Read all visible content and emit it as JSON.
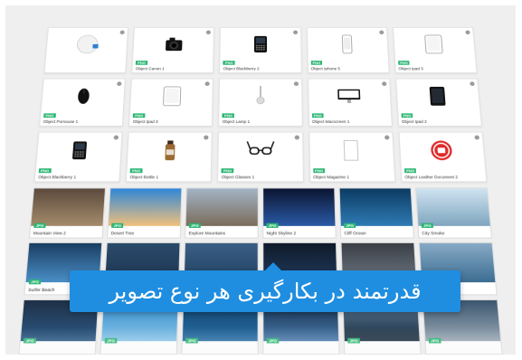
{
  "overlay": {
    "title": "قدرتمند در بکارگیری هر نوع تصویر"
  },
  "objects": {
    "row1": [
      {
        "label": "",
        "badge": "",
        "icon": "badge-mockup-icon"
      },
      {
        "label": "Object Canon 1",
        "badge": "PNG",
        "icon": "camera-icon"
      },
      {
        "label": "Object Blackberry 2",
        "badge": "PNG",
        "icon": "phone-keyboard-icon"
      },
      {
        "label": "Object Iphone 5",
        "badge": "PNG",
        "icon": "phone-icon"
      },
      {
        "label": "Object Ipad 3",
        "badge": "PNG",
        "icon": "tablet-icon"
      }
    ],
    "row2": [
      {
        "label": "Object Pomouse 1",
        "badge": "PNG",
        "icon": "mouse-icon"
      },
      {
        "label": "Object Ipad 3",
        "badge": "PNG",
        "icon": "tablet-icon"
      },
      {
        "label": "Object Lamp 1",
        "badge": "PNG",
        "icon": "lamp-icon"
      },
      {
        "label": "Object Macscreen 1",
        "badge": "PNG",
        "icon": "monitor-icon"
      },
      {
        "label": "Object Ipad 2",
        "badge": "PNG",
        "icon": "tablet-black-icon"
      }
    ],
    "row3": [
      {
        "label": "Object Blackberry 1",
        "badge": "PNG",
        "icon": "phone-keyboard-icon"
      },
      {
        "label": "Object Bottle 1",
        "badge": "PNG",
        "icon": "bottle-icon"
      },
      {
        "label": "Object Glasses 1",
        "badge": "PNG",
        "icon": "glasses-icon"
      },
      {
        "label": "Object Magazine 1",
        "badge": "PNG",
        "icon": "paper-icon"
      },
      {
        "label": "Object Leather Document 2",
        "badge": "PNG",
        "icon": "logo-icon"
      }
    ]
  },
  "photos": {
    "row1": [
      {
        "label": "Mountain View 2",
        "badge": "JPG",
        "colors": [
          "#5b4a3d",
          "#a48b6b"
        ]
      },
      {
        "label": "Desert Tree",
        "badge": "JPG",
        "colors": [
          "#2f87d8",
          "#f0c07b"
        ]
      },
      {
        "label": "Explore Mountains",
        "badge": "JPG",
        "colors": [
          "#a3b4c6",
          "#7b6c5a"
        ]
      },
      {
        "label": "Night Skyline 2",
        "badge": "JPG",
        "colors": [
          "#0b1430",
          "#2a5aa6"
        ]
      },
      {
        "label": "Cliff Ocean",
        "badge": "JPG",
        "colors": [
          "#0c3b61",
          "#2f7bb5"
        ]
      },
      {
        "label": "City Smoke",
        "badge": "JPG",
        "colors": [
          "#cfe3f0",
          "#7fa6bf"
        ]
      }
    ],
    "row2": [
      {
        "label": "Surfer Beach",
        "badge": "JPG",
        "colors": [
          "#1a3d62",
          "#4a8fc7"
        ]
      },
      {
        "label": "",
        "badge": "",
        "colors": [
          "#2b4b6b",
          "#1d3550"
        ]
      },
      {
        "label": "",
        "badge": "",
        "colors": [
          "#3a5f86",
          "#20405e"
        ]
      },
      {
        "label": "",
        "badge": "",
        "colors": [
          "#0f1a2a",
          "#203b5d"
        ]
      },
      {
        "label": "",
        "badge": "",
        "colors": [
          "#3b3f46",
          "#6c7784"
        ]
      },
      {
        "label": "",
        "badge": "",
        "colors": [
          "#87aac6",
          "#3c6d92"
        ]
      }
    ],
    "row3": [
      {
        "label": "",
        "badge": "JPG",
        "colors": [
          "#1e2f45",
          "#2d5a87"
        ]
      },
      {
        "label": "",
        "badge": "JPG",
        "colors": [
          "#2a86c7",
          "#8cc6ea"
        ]
      },
      {
        "label": "",
        "badge": "JPG",
        "colors": [
          "#0e3d66",
          "#2a70a7"
        ]
      },
      {
        "label": "",
        "badge": "JPG",
        "colors": [
          "#0f2743",
          "#4c7cad"
        ]
      },
      {
        "label": "",
        "badge": "JPG",
        "colors": [
          "#5b7b98",
          "#1d2e3f"
        ]
      },
      {
        "label": "",
        "badge": "JPG",
        "colors": [
          "#3b566f",
          "#9aa8b5"
        ]
      }
    ]
  },
  "colors": {
    "accent": "#1f8ee0",
    "badge": "#2bb673",
    "background": "#efefef"
  }
}
